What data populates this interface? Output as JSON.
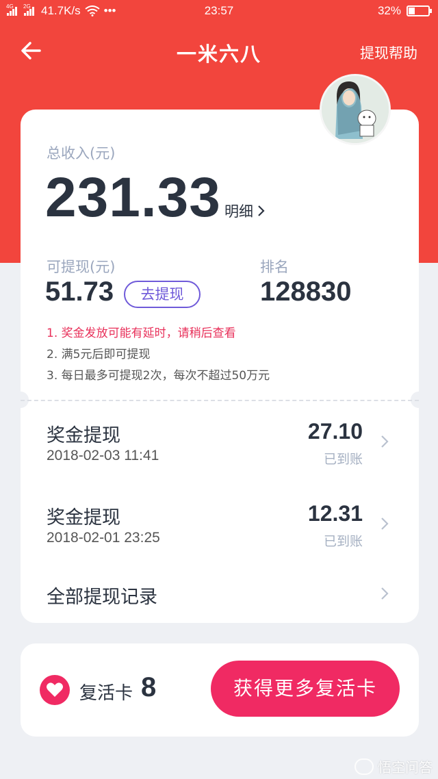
{
  "status_bar": {
    "net_left": "4G",
    "net_right": "2G",
    "speed": "41.7K/s",
    "more": "•••",
    "time": "23:57",
    "battery_text": "32%",
    "battery_level": 0.32
  },
  "header": {
    "title": "一米六八",
    "help": "提现帮助"
  },
  "summary": {
    "total_label": "总收入(元)",
    "total_value": "231.33",
    "detail_link": "明细",
    "withdrawable_label": "可提现(元)",
    "withdrawable_value": "51.73",
    "withdraw_button": "去提现",
    "rank_label": "排名",
    "rank_value": "128830"
  },
  "notes": [
    "1. 奖金发放可能有延时，请稍后查看",
    "2. 满5元后即可提现",
    "3. 每日最多可提现2次，每次不超过50万元"
  ],
  "records": [
    {
      "title": "奖金提现",
      "date": "2018-02-03 11:41",
      "amount": "27.10",
      "status": "已到账"
    },
    {
      "title": "奖金提现",
      "date": "2018-02-01 23:25",
      "amount": "12.31",
      "status": "已到账"
    }
  ],
  "all_records": "全部提现记录",
  "revive": {
    "label": "复活卡",
    "count": "8",
    "button": "获得更多复活卡"
  },
  "watermark": "悟空问答",
  "colors": {
    "header_red": "#f2453d",
    "accent_pink": "#f02a63",
    "withdraw_purple": "#6f5ad9",
    "note_red": "#e8305a"
  }
}
